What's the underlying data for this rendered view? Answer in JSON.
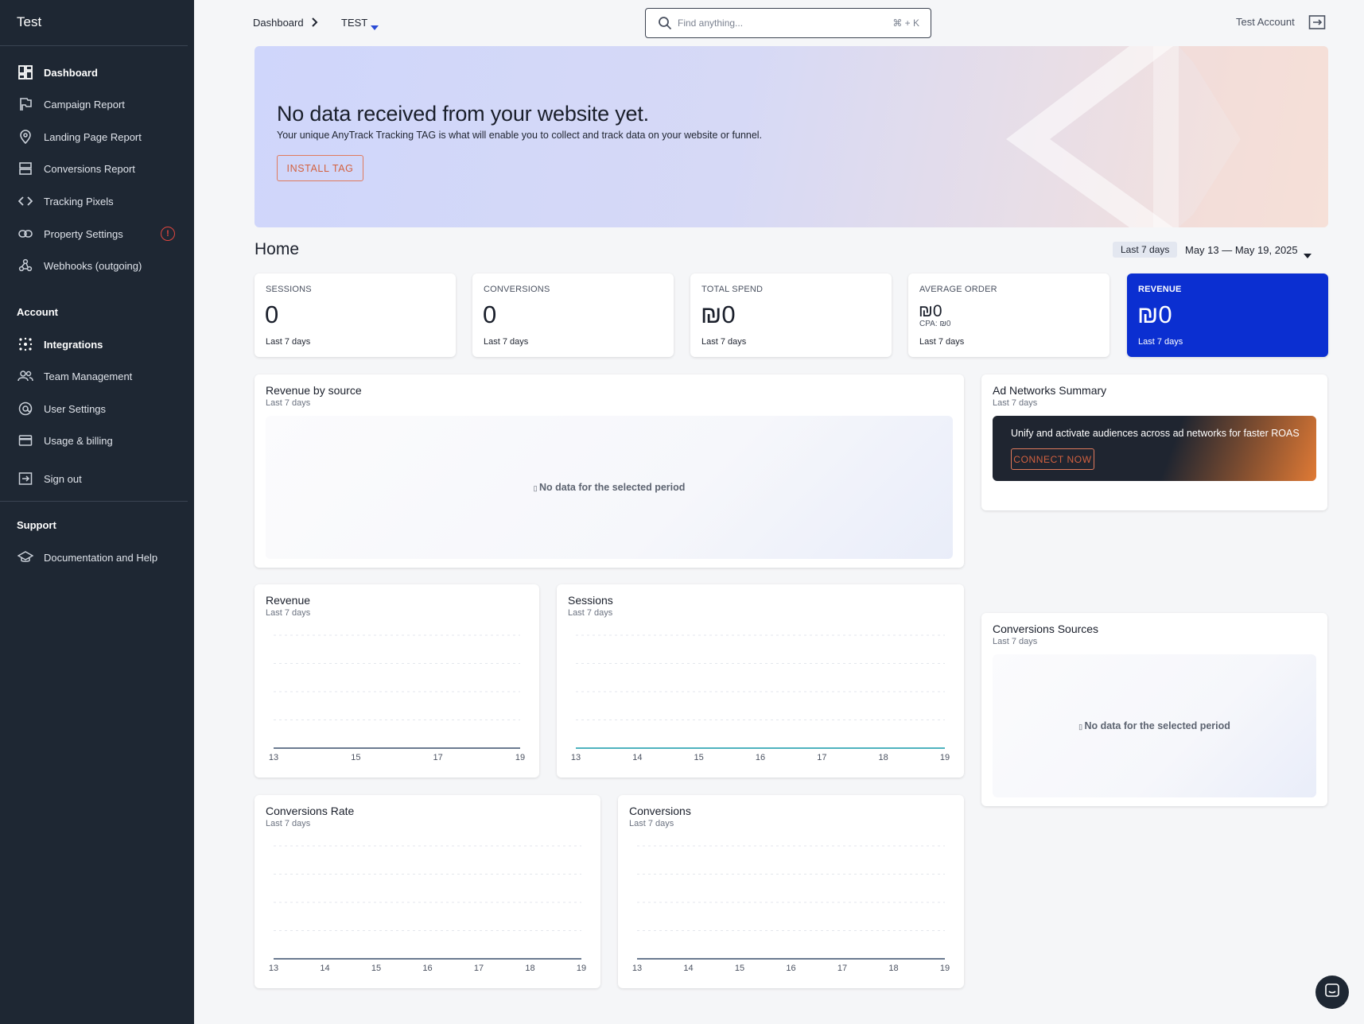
{
  "sidebar": {
    "title": "Test",
    "items": [
      {
        "label": "Dashboard"
      },
      {
        "label": "Campaign Report"
      },
      {
        "label": "Landing Page Report"
      },
      {
        "label": "Conversions Report"
      },
      {
        "label": "Tracking Pixels"
      },
      {
        "label": "Property Settings"
      },
      {
        "label": "Webhooks (outgoing)"
      }
    ],
    "account_heading": "Account",
    "account_items": [
      {
        "label": "Integrations"
      },
      {
        "label": "Team Management"
      },
      {
        "label": "User Settings"
      },
      {
        "label": "Usage & billing"
      },
      {
        "label": "Sign out"
      }
    ],
    "support_heading": "Support",
    "support_items": [
      {
        "label": "Documentation and Help"
      }
    ],
    "alert_badge": "!"
  },
  "topbar": {
    "breadcrumb_root": "Dashboard",
    "property": "TEST",
    "search_placeholder": "Find anything...",
    "search_shortcut": "⌘ + K",
    "account": "Test Account"
  },
  "banner": {
    "title": "No data received from your website yet.",
    "text": "Your unique AnyTrack Tracking TAG is what will enable you to collect and track data on your website or funnel.",
    "button": "INSTALL TAG"
  },
  "home": {
    "title": "Home",
    "range_pill": "Last 7 days",
    "date_range": "May 13 — May 19, 2025"
  },
  "kpis": [
    {
      "label": "SESSIONS",
      "value": "0",
      "sub": "Last 7 days"
    },
    {
      "label": "CONVERSIONS",
      "value": "0",
      "sub": "Last 7 days"
    },
    {
      "label": "TOTAL SPEND",
      "value": "₪0",
      "sub": "Last 7 days"
    },
    {
      "label": "AVERAGE ORDER",
      "value": "₪0",
      "cpa": "CPA: ₪0",
      "sub": "Last 7 days"
    },
    {
      "label": "REVENUE",
      "value": "₪0",
      "sub": "Last 7 days"
    }
  ],
  "revenue_by_source": {
    "title": "Revenue by source",
    "sub": "Last 7 days",
    "empty": "No data for the selected period"
  },
  "ad_networks": {
    "title": "Ad Networks Summary",
    "sub": "Last 7 days",
    "promo_text": "Unify and activate audiences across ad networks for faster ROAS",
    "button": "CONNECT NOW"
  },
  "conversion_sources": {
    "title": "Conversions Sources",
    "sub": "Last 7 days",
    "empty": "No data for the selected period"
  },
  "accent": "#0b2fd1",
  "chart_data": [
    {
      "type": "line",
      "title": "Revenue",
      "subtitle": "Last 7 days",
      "x": [
        "13",
        "15",
        "17",
        "19"
      ],
      "series": [
        {
          "values": [
            0,
            0,
            0,
            0
          ],
          "color": "#6b7a90"
        }
      ]
    },
    {
      "type": "line",
      "title": "Sessions",
      "subtitle": "Last 7 days",
      "x": [
        "13",
        "14",
        "15",
        "16",
        "17",
        "18",
        "19"
      ],
      "series": [
        {
          "values": [
            0,
            0,
            0,
            0,
            0,
            0,
            0
          ],
          "color": "#4fb3bf"
        }
      ]
    },
    {
      "type": "line",
      "title": "Conversions Rate",
      "subtitle": "Last 7 days",
      "x": [
        "13",
        "14",
        "15",
        "16",
        "17",
        "18",
        "19"
      ],
      "series": [
        {
          "values": [
            0,
            0,
            0,
            0,
            0,
            0,
            0
          ],
          "color": "#6b7a90"
        }
      ]
    },
    {
      "type": "line",
      "title": "Conversions",
      "subtitle": "Last 7 days",
      "x": [
        "13",
        "14",
        "15",
        "16",
        "17",
        "18",
        "19"
      ],
      "series": [
        {
          "values": [
            0,
            0,
            0,
            0,
            0,
            0,
            0
          ],
          "color": "#6b7a90"
        }
      ]
    }
  ]
}
